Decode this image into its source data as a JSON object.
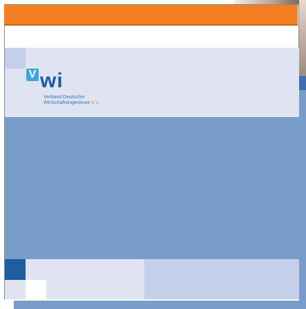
{
  "logo": {
    "mark": "V",
    "wordmark": "wi",
    "subtitle_line1": "Verband Deutscher",
    "subtitle_line2": "Wirtschaftsingenieure",
    "subtitle_suffix": "e.V."
  },
  "colors": {
    "accent_orange": "#f47f22",
    "brand_blue": "#1a5aa6",
    "band_blue": "#7a9cc8",
    "pale_blue": "#dfe3f2"
  }
}
